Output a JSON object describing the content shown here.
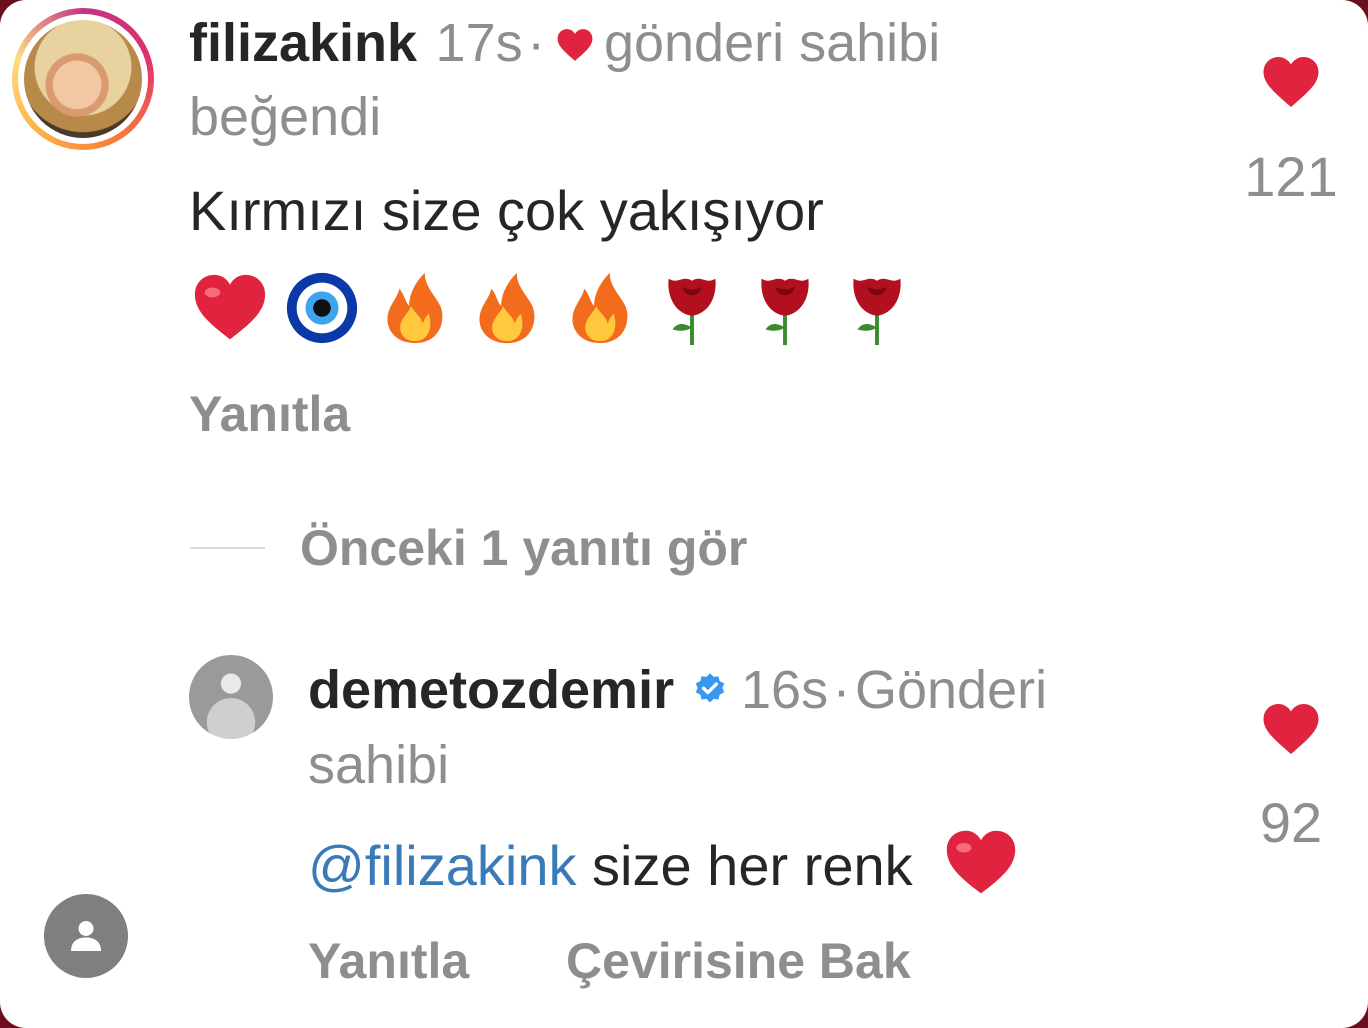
{
  "comment": {
    "username": "filizakink",
    "time": "17s",
    "separator": "·",
    "liked_by_owner": "gönderi sahibi",
    "liked_by_owner_2": "beğendi",
    "text": "Kırmızı size çok yakışıyor",
    "emojis": [
      "heart",
      "nazar",
      "fire",
      "fire",
      "fire",
      "rose",
      "rose",
      "rose"
    ],
    "reply_label": "Yanıtla",
    "like_count": "121"
  },
  "view_replies": "Önceki 1 yanıtı gör",
  "reply": {
    "username": "demetozdemir",
    "time": "16s",
    "separator": "·",
    "owner_label_1": "Gönderi",
    "owner_label_2": "sahibi",
    "mention": "@filizakink",
    "text": "size her renk",
    "reply_label": "Yanıtla",
    "translate_label": "Çevirisine Bak",
    "like_count": "92"
  },
  "colors": {
    "heart": "#e0243f",
    "meta": "#8e8e8e",
    "mention": "#3b7ab8",
    "verified": "#3897f0"
  }
}
